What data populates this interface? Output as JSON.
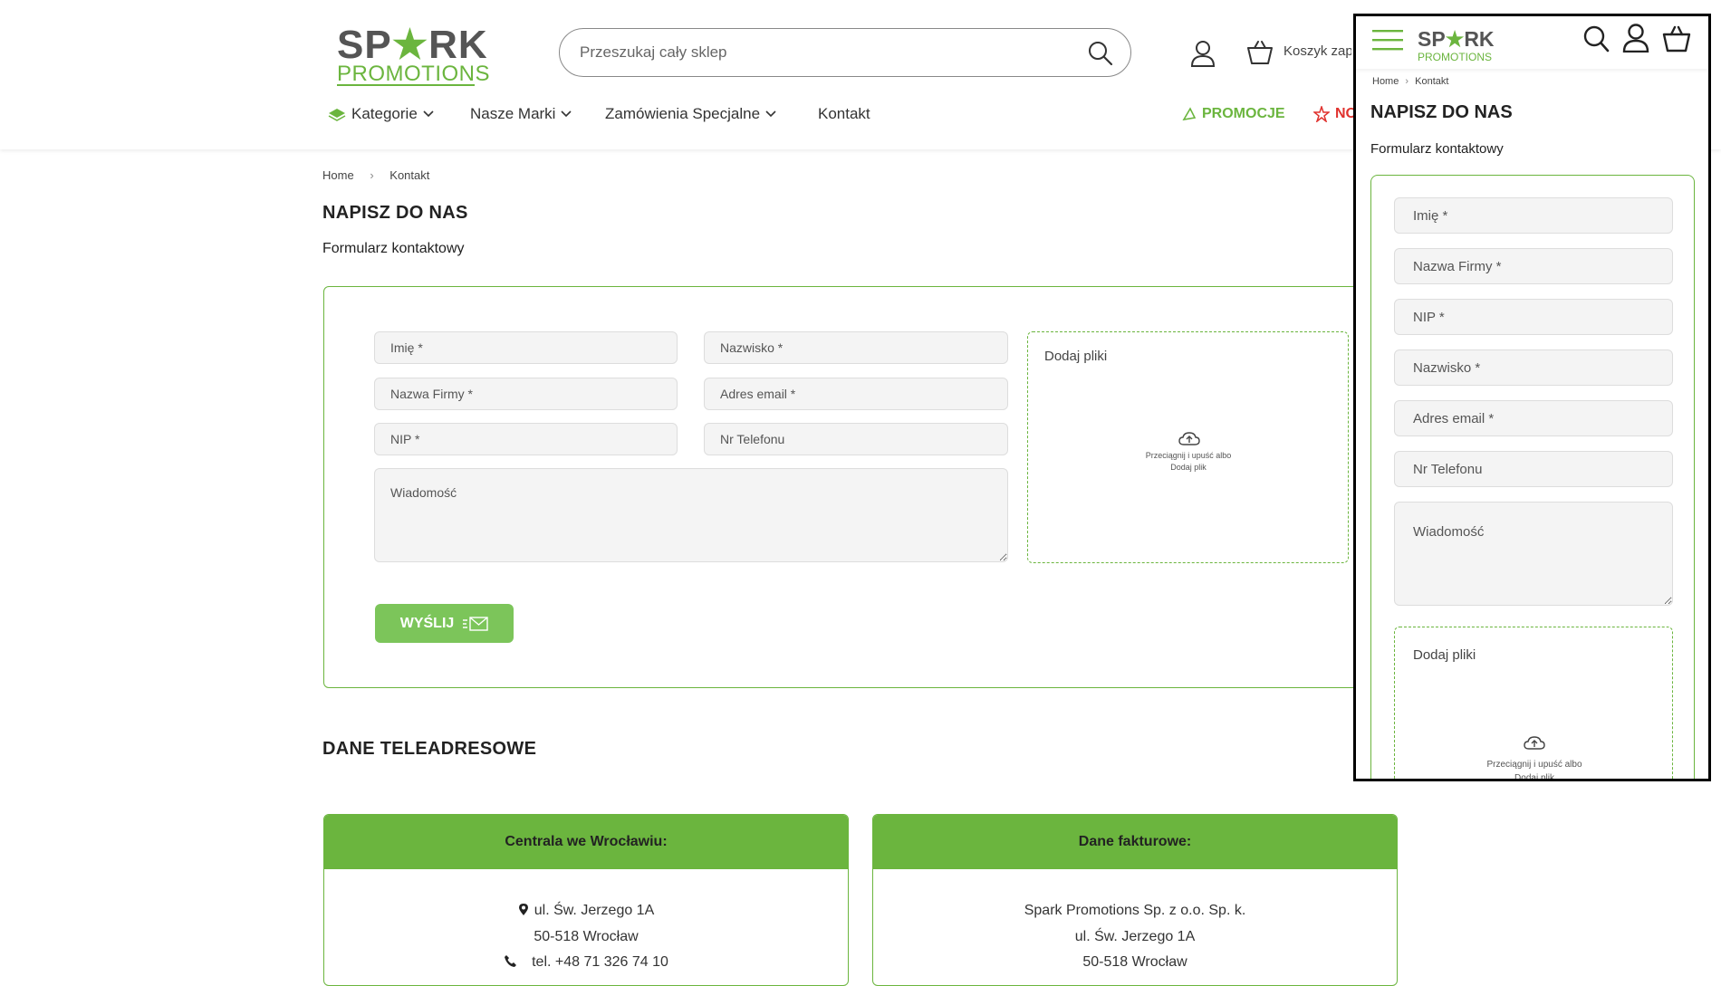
{
  "header": {
    "logo_top_left": "SP",
    "logo_star": "★",
    "logo_top_right": "RK",
    "logo_bottom": "PROMOTIONS",
    "search_placeholder": "Przeszukaj cały sklep",
    "cart_label": "Koszyk zap",
    "nav": [
      {
        "label": "Kategorie"
      },
      {
        "label": "Nasze Marki"
      },
      {
        "label": "Zamówienia Specjalne"
      },
      {
        "label": "Kontakt"
      }
    ],
    "promo_label": "PROMOCJE",
    "new_label": "NO"
  },
  "breadcrumb": {
    "home": "Home",
    "sep": "›",
    "current": "Kontakt"
  },
  "page_title": "NAPISZ DO NAS",
  "form_title": "Formularz kontaktowy",
  "form": {
    "imie": "Imię *",
    "nazwisko": "Nazwisko *",
    "firma": "Nazwa Firmy *",
    "email": "Adres email *",
    "nip": "NIP *",
    "telefon": "Nr Telefonu",
    "wiadomosc": "Wiadomość",
    "upload_title": "Dodaj pliki",
    "upload_hint_1": "Przeciągnij i upuść albo",
    "upload_hint_2": "Dodaj plik",
    "submit": "WYŚLIJ"
  },
  "contact_title": "DANE TELEADRESOWE",
  "cards": [
    {
      "title": "Centrala we Wrocławiu:",
      "lines": [
        "ul. Św. Jerzego 1A",
        "50-518 Wrocław",
        "tel. +48 71 326 74 10"
      ]
    },
    {
      "title": "Dane fakturowe:",
      "lines": [
        "Spark Promotions Sp. z o.o. Sp. k.",
        "ul. Św. Jerzego 1A",
        "50-518 Wrocław"
      ]
    }
  ],
  "mobile": {
    "breadcrumb_home": "Home",
    "breadcrumb_sep": "›",
    "breadcrumb_current": "Kontakt",
    "title": "NAPISZ DO NAS",
    "form_title": "Formularz kontaktowy",
    "fields": [
      "Imię *",
      "Nazwa Firmy *",
      "NIP *",
      "Nazwisko *",
      "Adres email *",
      "Nr Telefonu"
    ],
    "wiadomosc": "Wiadomość",
    "upload_title": "Dodaj pliki",
    "upload_hint_1": "Przeciągnij i upuść albo",
    "upload_hint_2": "Dodaj plik"
  },
  "colors": {
    "brand_green": "#6bb53e",
    "button_green": "#7cc55a",
    "accent_red": "#e0322e"
  }
}
